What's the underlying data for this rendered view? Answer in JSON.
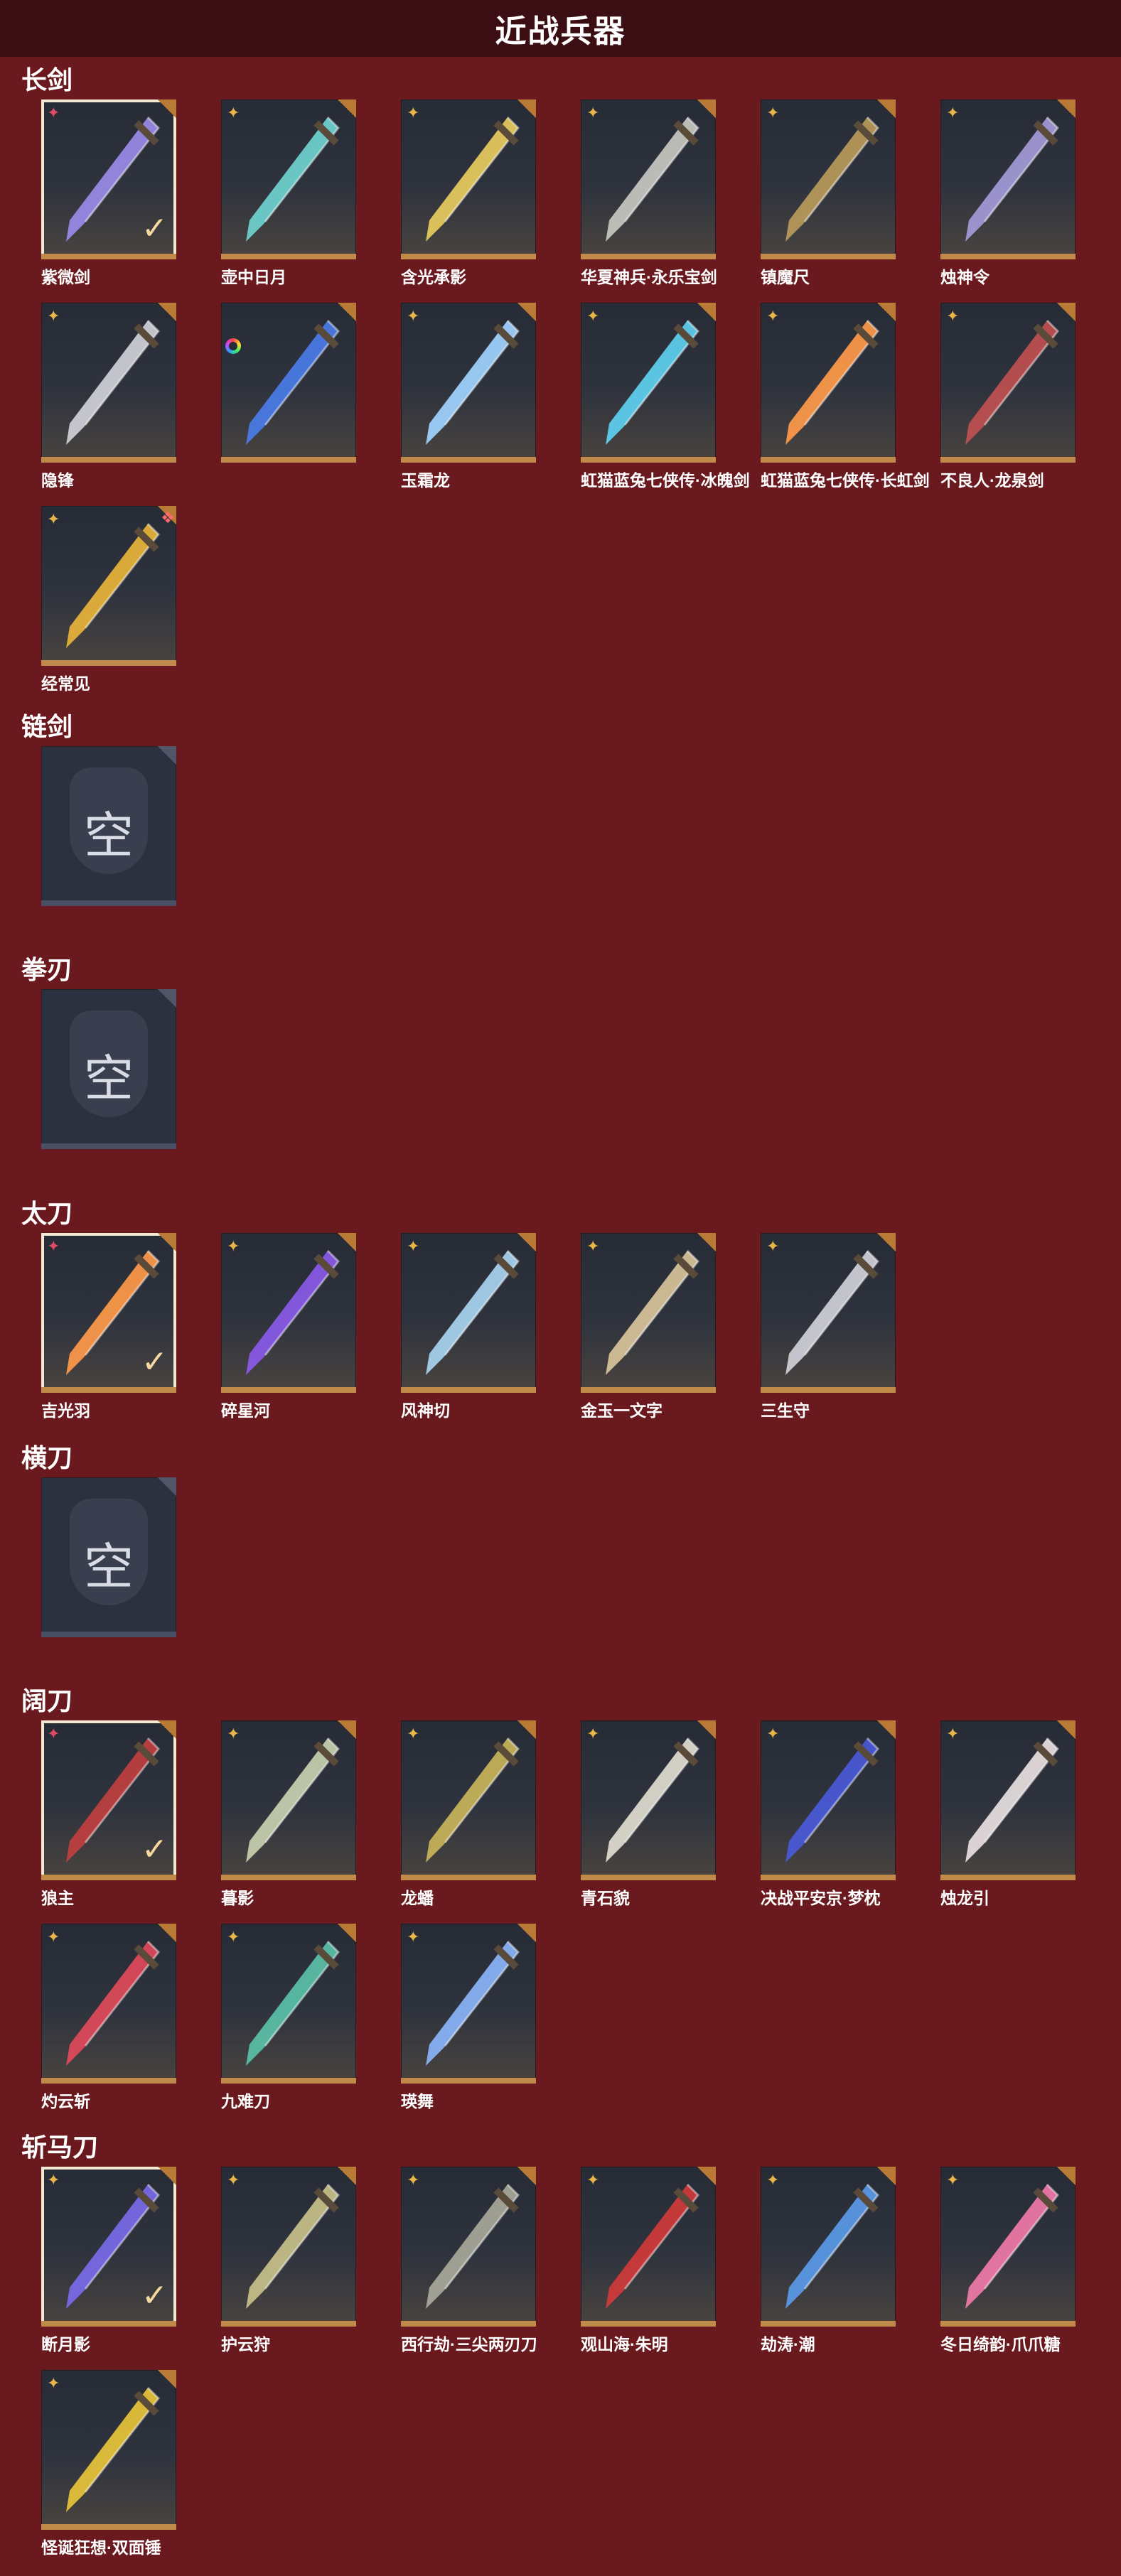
{
  "title": "近战兵器",
  "empty_text": "空",
  "sections": [
    {
      "title": "长剑",
      "items": [
        {
          "name": "紫微剑",
          "rank": "pink",
          "selected": true,
          "blade": "#9a8be8"
        },
        {
          "name": "壶中日月",
          "rank": "gold",
          "blade": "#6fd2cf"
        },
        {
          "name": "含光承影",
          "rank": "gold",
          "blade": "#e8cc5e"
        },
        {
          "name": "华夏神兵·永乐宝剑",
          "rank": "gold",
          "blade": "#c8c8c0"
        },
        {
          "name": "镇魔尺",
          "rank": "gold",
          "blade": "#b89a5a"
        },
        {
          "name": "烛神令",
          "rank": "gold",
          "blade": "#a49ad8"
        },
        {
          "name": "隐锋",
          "rank": "gold",
          "blade": "#d0d0d8"
        },
        {
          "name": "",
          "rank": "rainbow",
          "blade": "#4a7ce8"
        },
        {
          "name": "玉霜龙",
          "rank": "gold",
          "blade": "#9fd4ff"
        },
        {
          "name": "虹猫蓝兔七侠传·冰魄剑",
          "rank": "gold",
          "blade": "#5ed0f0"
        },
        {
          "name": "虹猫蓝兔七侠传·长虹剑",
          "rank": "gold",
          "blade": "#ff9a4a"
        },
        {
          "name": "不良人·龙泉剑",
          "rank": "gold",
          "blade": "#c05050"
        },
        {
          "name": "经常见",
          "rank": "gold",
          "gift": true,
          "blade": "#e8b43a"
        }
      ]
    },
    {
      "title": "链剑",
      "items": []
    },
    {
      "title": "拳刃",
      "items": []
    },
    {
      "title": "太刀",
      "items": [
        {
          "name": "吉光羽",
          "rank": "pink",
          "selected": true,
          "blade": "#ff9a4a"
        },
        {
          "name": "碎星河",
          "rank": "gold",
          "blade": "#8a5ae8"
        },
        {
          "name": "风神切",
          "rank": "gold",
          "blade": "#a8d4f0"
        },
        {
          "name": "金玉一文字",
          "rank": "gold",
          "blade": "#d8c49a"
        },
        {
          "name": "三生守",
          "rank": "gold",
          "blade": "#d0d0d8"
        }
      ]
    },
    {
      "title": "横刀",
      "items": []
    },
    {
      "title": "阔刀",
      "items": [
        {
          "name": "狼主",
          "rank": "pink",
          "selected": true,
          "blade": "#c04040"
        },
        {
          "name": "暮影",
          "rank": "gold",
          "blade": "#c8d0b0"
        },
        {
          "name": "龙蟠",
          "rank": "gold",
          "blade": "#c8b45a"
        },
        {
          "name": "青石貌",
          "rank": "gold",
          "blade": "#e0dcd0"
        },
        {
          "name": "决战平安京·梦枕",
          "rank": "gold",
          "blade": "#4a5ad8"
        },
        {
          "name": "烛龙引",
          "rank": "gold",
          "blade": "#e8e0e0"
        },
        {
          "name": "灼云斩",
          "rank": "gold",
          "blade": "#e04a5a"
        },
        {
          "name": "九难刀",
          "rank": "gold",
          "blade": "#5ac0a8"
        },
        {
          "name": "瑛舞",
          "rank": "gold",
          "blade": "#8ab4f8"
        }
      ]
    },
    {
      "title": "斩马刀",
      "items": [
        {
          "name": "断月影",
          "rank": "gold",
          "selected": true,
          "blade": "#7a6ae8"
        },
        {
          "name": "护云狩",
          "rank": "gold",
          "blade": "#c8c08a"
        },
        {
          "name": "西行劫·三尖两刃刀",
          "rank": "gold",
          "blade": "#a8a89a"
        },
        {
          "name": "观山海·朱明",
          "rank": "gold",
          "blade": "#d03a3a"
        },
        {
          "name": "劫涛·潮",
          "rank": "gold",
          "blade": "#5a9ae8"
        },
        {
          "name": "冬日绮韵·爪爪糖",
          "rank": "gold",
          "blade": "#f07aa8"
        },
        {
          "name": "怪诞狂想·双面锤",
          "rank": "gold",
          "blade": "#e8c43a"
        }
      ]
    }
  ]
}
